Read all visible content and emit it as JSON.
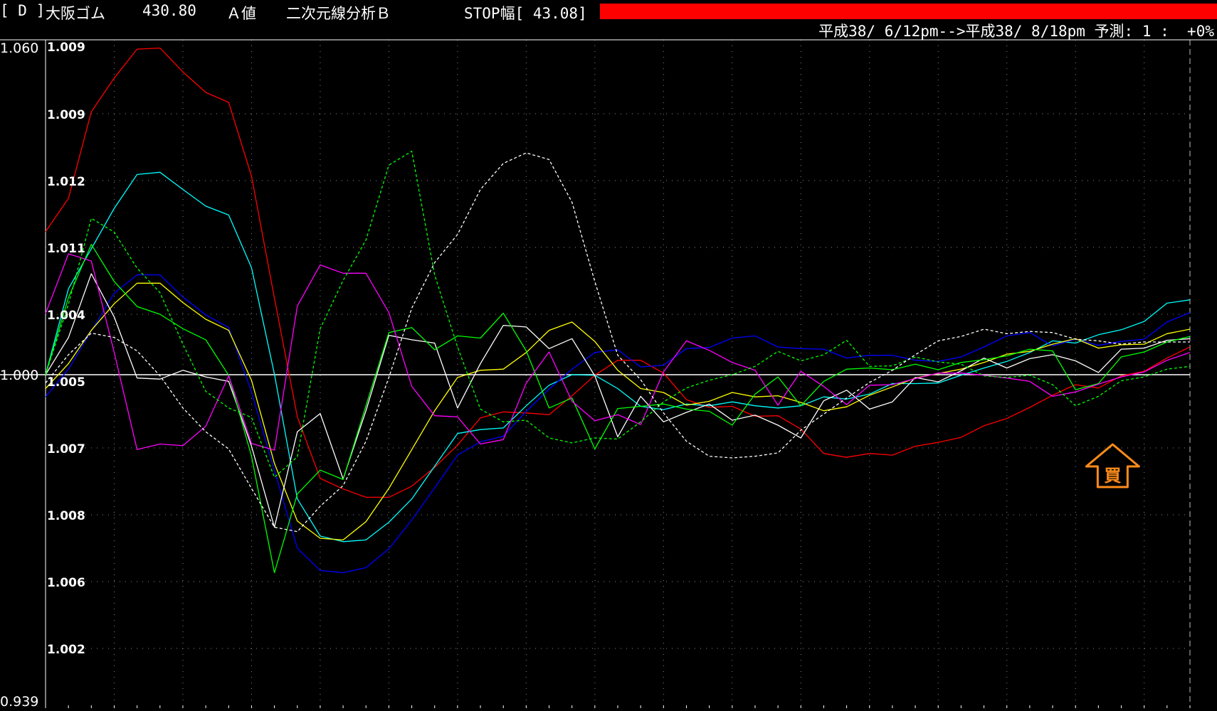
{
  "header": {
    "code": "[ D ]",
    "name": "大阪ゴム",
    "price": "430.80",
    "mode": "Ａ値",
    "analysis": "二次元線分析Ｂ",
    "stop": "STOP幅[ 43.08]",
    "stop_bar_color": "#ff0000"
  },
  "subheader": {
    "period": "平成38/ 6/12pm-->平成38/ 8/18pm 予測: 1 :  +0%"
  },
  "chart_data": {
    "type": "line",
    "y_axis_outer": {
      "top": "1.060",
      "middle": "1.000",
      "bottom": "0.939"
    },
    "y_axis_inner": [
      "1.009",
      "1.009",
      "1.012",
      "1.011",
      "1.004",
      "1.005",
      "1.007",
      "1.008",
      "1.006",
      "1.002"
    ],
    "baseline_value": 1.0,
    "ylim": [
      0.939,
      1.06
    ],
    "x_count": 50,
    "grid": true,
    "annotation": {
      "label": "買",
      "x_index": 46,
      "y": 0.9855,
      "color": "#ff8c1a"
    },
    "series": [
      {
        "color": "#ff0000",
        "dashed": false,
        "values": [
          1.0258,
          1.0318,
          1.0474,
          1.0535,
          1.0587,
          1.0589,
          1.0546,
          1.0509,
          1.0491,
          1.0358,
          1.0138,
          0.9924,
          0.9813,
          0.9794,
          0.9779,
          0.9779,
          0.9799,
          0.9833,
          0.9873,
          0.9922,
          0.9933,
          0.9931,
          0.9928,
          0.9962,
          0.9999,
          1.0026,
          1.0026,
          1.0003,
          0.9955,
          0.9941,
          0.9943,
          0.9925,
          0.9926,
          0.9902,
          0.9858,
          0.9851,
          0.9858,
          0.9855,
          0.9871,
          0.9878,
          0.9887,
          0.9908,
          0.9921,
          0.9941,
          0.9963,
          0.9982,
          0.9976,
          0.9998,
          1.0006,
          1.003,
          1.005
        ]
      },
      {
        "color": "#00ffff",
        "dashed": false,
        "values": [
          1.0,
          1.0155,
          1.0227,
          1.03,
          1.0361,
          1.0365,
          1.0334,
          1.0304,
          1.0288,
          1.0193,
          1.0001,
          0.9776,
          0.9709,
          0.9699,
          0.9702,
          0.9734,
          0.9776,
          0.9835,
          0.9894,
          0.9901,
          0.9904,
          0.9944,
          0.9981,
          1.0,
          0.9999,
          0.9975,
          0.9943,
          0.9937,
          0.9947,
          0.9944,
          0.9951,
          0.9944,
          0.994,
          0.9944,
          0.996,
          0.9956,
          0.9965,
          0.9984,
          0.9984,
          0.9985,
          0.9999,
          1.0012,
          1.0024,
          1.004,
          1.0061,
          1.0057,
          1.0072,
          1.0081,
          1.0096,
          1.0129,
          1.0135
        ]
      },
      {
        "color": "#0000ff",
        "dashed": false,
        "values": [
          0.996,
          1.001,
          1.0079,
          1.0147,
          1.018,
          1.018,
          1.014,
          1.0108,
          1.0085,
          0.9969,
          0.9827,
          0.9687,
          0.9647,
          0.9643,
          0.9652,
          0.9686,
          0.9738,
          0.9796,
          0.9855,
          0.9879,
          0.9889,
          0.9934,
          0.9974,
          1.001,
          1.004,
          1.0045,
          1.0014,
          1.0017,
          1.0047,
          1.0049,
          1.0066,
          1.007,
          1.005,
          1.0047,
          1.0046,
          1.003,
          1.0035,
          1.0035,
          1.0026,
          1.0024,
          1.0032,
          1.005,
          1.007,
          1.0076,
          1.0052,
          1.0064,
          1.0053,
          1.006,
          1.0064,
          1.0095,
          1.0112
        ]
      },
      {
        "color": "#ffff00",
        "dashed": false,
        "values": [
          0.9975,
          1.002,
          1.008,
          1.0128,
          1.0165,
          1.0165,
          1.013,
          1.01,
          1.008,
          0.999,
          0.984,
          0.9736,
          0.9705,
          0.9702,
          0.9735,
          0.9795,
          0.9865,
          0.9935,
          0.9995,
          1.0008,
          1.001,
          1.004,
          1.008,
          1.0095,
          1.006,
          1.0008,
          0.9975,
          0.9968,
          0.9945,
          0.9952,
          0.9968,
          0.996,
          0.9962,
          0.995,
          0.9935,
          0.9942,
          0.9963,
          0.9978,
          0.9994,
          1.0002,
          1.001,
          1.0022,
          1.0037,
          1.0042,
          1.0055,
          1.0065,
          1.0048,
          1.0054,
          1.0055,
          1.0074,
          1.0082
        ]
      },
      {
        "color": "#ffffff",
        "dashed": false,
        "values": [
          1.0,
          1.0067,
          1.0182,
          1.0104,
          0.9994,
          0.9992,
          1.0008,
          0.9996,
          0.9988,
          0.9871,
          0.9725,
          0.9897,
          0.993,
          0.9812,
          0.9935,
          1.0071,
          1.0063,
          1.0057,
          0.994,
          1.002,
          1.0089,
          1.0086,
          1.0047,
          1.0065,
          0.9998,
          0.9888,
          0.9961,
          0.9915,
          0.9932,
          0.9947,
          0.9918,
          0.9927,
          0.9909,
          0.9886,
          0.9953,
          0.9972,
          0.9938,
          0.9951,
          0.9995,
          0.9987,
          1.0007,
          1.003,
          1.0012,
          1.0029,
          1.0036,
          1.0025,
          1.0004,
          1.0046,
          1.0048,
          1.0062,
          1.0065
        ]
      },
      {
        "color": "#00ff00",
        "dashed": false,
        "values": [
          1.0,
          1.0139,
          1.0235,
          1.0168,
          1.0123,
          1.0109,
          1.0083,
          1.0063,
          0.9999,
          0.9853,
          0.9643,
          0.9785,
          0.9828,
          0.9811,
          0.9944,
          1.0076,
          1.0085,
          1.0045,
          1.007,
          1.0066,
          1.0111,
          1.0043,
          0.994,
          0.9958,
          0.9866,
          0.9939,
          0.9943,
          0.9947,
          0.9938,
          0.9934,
          0.9909,
          0.9965,
          0.9996,
          0.9944,
          0.9988,
          1.001,
          1.0012,
          1.0009,
          1.0019,
          1.0009,
          1.0022,
          1.0027,
          1.0034,
          1.0046,
          1.0043,
          0.9973,
          0.9984,
          1.0032,
          1.0041,
          1.0059,
          1.0069
        ]
      },
      {
        "color": "#ff00ff",
        "dashed": false,
        "values": [
          1.011,
          1.0218,
          1.0205,
          1.004,
          0.9865,
          0.9875,
          0.9872,
          0.9907,
          0.9998,
          0.9876,
          0.9864,
          1.0124,
          1.0198,
          1.0183,
          1.0183,
          1.0112,
          0.9979,
          0.9926,
          0.9924,
          0.9875,
          0.9883,
          0.9985,
          1.0041,
          0.9952,
          0.9917,
          0.9928,
          0.991,
          1.0005,
          1.0061,
          1.0044,
          1.0022,
          1.0008,
          0.9945,
          1.0006,
          0.9979,
          0.9946,
          0.9981,
          0.9982,
          0.9993,
          1.0003,
          1.0003,
          0.9999,
          0.9994,
          0.9988,
          0.9961,
          0.9969,
          0.9983,
          0.9996,
          1.0005,
          1.0026,
          1.004
        ]
      },
      {
        "color": "#00ff00",
        "dashed": true,
        "values": [
          1.0,
          1.0127,
          1.0282,
          1.0257,
          1.0192,
          1.0148,
          1.0055,
          0.997,
          0.994,
          0.9923,
          0.9815,
          0.9852,
          1.0083,
          1.017,
          1.0243,
          1.0378,
          1.0403,
          1.018,
          1.005,
          0.9938,
          0.9915,
          0.9918,
          0.9886,
          0.9877,
          0.9886,
          0.9884,
          0.9915,
          0.9951,
          0.9976,
          0.999,
          1.0,
          1.0015,
          1.0042,
          1.0025,
          1.0036,
          1.0062,
          1.0015,
          1.0016,
          1.0032,
          1.0023,
          1.0019,
          0.9998,
          0.9995,
          0.9999,
          0.9982,
          0.9944,
          0.9961,
          0.9989,
          0.9996,
          1.001,
          1.0015
        ]
      },
      {
        "color": "#ffffff",
        "dashed": true,
        "values": [
          0.9985,
          1.0036,
          1.0075,
          1.0067,
          1.0043,
          0.9998,
          0.994,
          0.9897,
          0.9866,
          0.9795,
          0.9725,
          0.9717,
          0.9763,
          0.98,
          0.988,
          0.9995,
          1.012,
          1.0202,
          1.0253,
          1.0334,
          1.0381,
          1.04,
          1.0388,
          1.0311,
          1.0168,
          1.0035,
          0.9991,
          0.9931,
          0.988,
          0.9853,
          0.985,
          0.9853,
          0.9859,
          0.99,
          0.9929,
          0.9958,
          0.9986,
          1.0008,
          1.0036,
          1.0061,
          1.0069,
          1.0082,
          1.0074,
          1.0078,
          1.0076,
          1.0064,
          1.0061,
          1.0055,
          1.0059,
          1.0059,
          1.0059
        ]
      }
    ]
  }
}
